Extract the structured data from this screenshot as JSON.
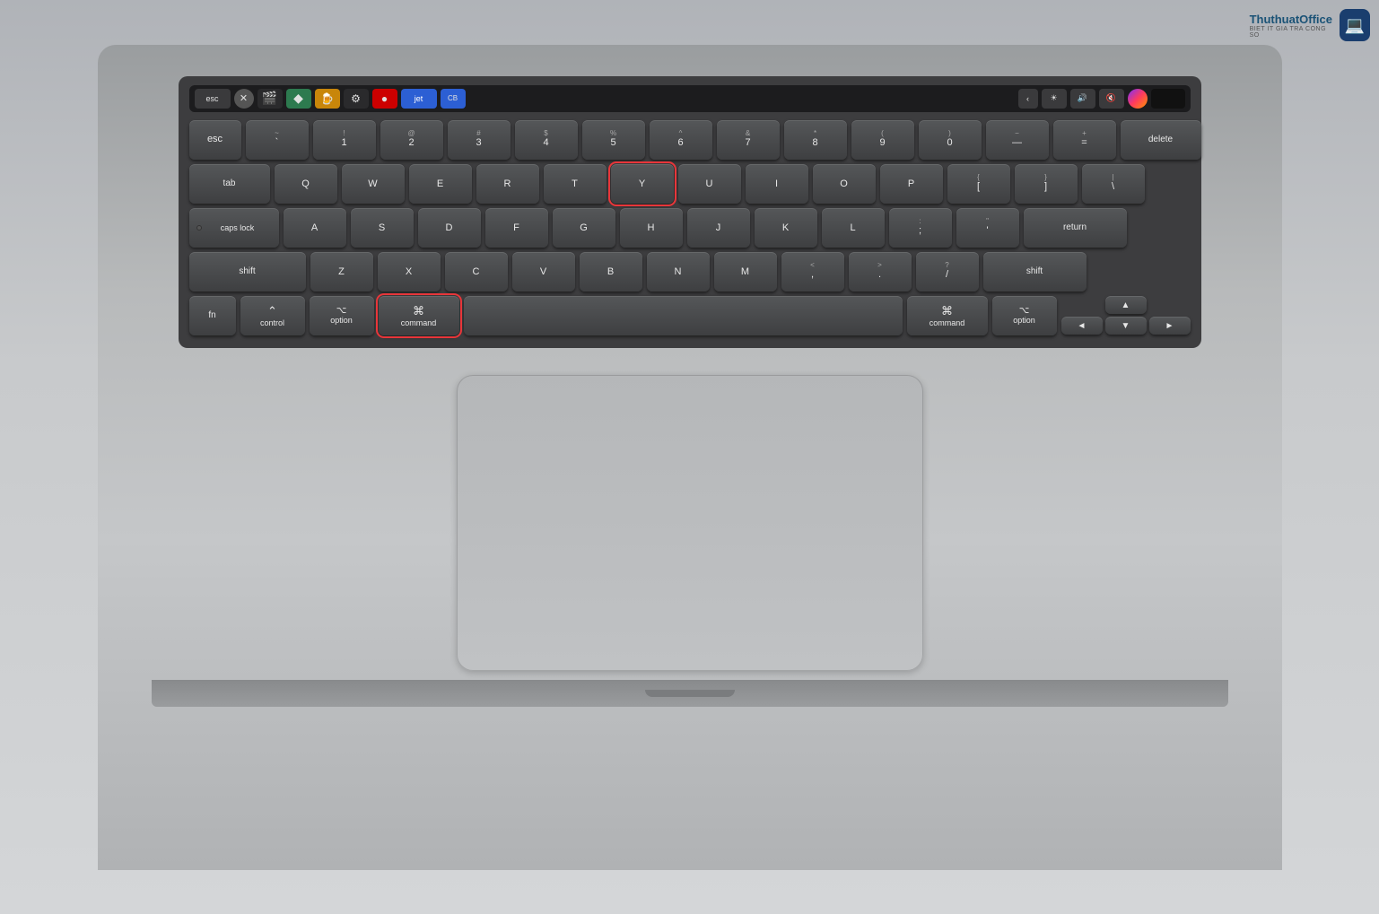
{
  "logo": {
    "name": "ThuthuatOffice",
    "sub": "BIET IT GIA TRA CONG SO",
    "icon": "💻"
  },
  "keyboard": {
    "touch_bar": {
      "keys": [
        "esc",
        "✕",
        "🎬",
        "◆",
        "🍺",
        "⚙",
        "●",
        "jet",
        "CB",
        "‹",
        "☀",
        "🔊",
        "🔇",
        "🔮",
        "■"
      ]
    },
    "rows": [
      {
        "id": "row_numbers",
        "keys": [
          {
            "label": "~\n`",
            "size": "1u"
          },
          {
            "label": "!\n1",
            "size": "1u"
          },
          {
            "label": "@\n2",
            "size": "1u"
          },
          {
            "label": "#\n3",
            "size": "1u"
          },
          {
            "label": "$\n4",
            "size": "1u"
          },
          {
            "label": "%\n5",
            "size": "1u"
          },
          {
            "label": "^\n6",
            "size": "1u"
          },
          {
            "label": "&\n7",
            "size": "1u"
          },
          {
            "label": "*\n8",
            "size": "1u"
          },
          {
            "label": "(\n9",
            "size": "1u"
          },
          {
            "label": ")\n0",
            "size": "1u"
          },
          {
            "label": "−\n—",
            "size": "1u"
          },
          {
            "label": "+\n=",
            "size": "1u"
          },
          {
            "label": "delete",
            "size": "delete"
          }
        ]
      },
      {
        "id": "row_qwerty",
        "keys": [
          {
            "label": "tab",
            "size": "tab"
          },
          {
            "label": "Q",
            "size": "1u"
          },
          {
            "label": "W",
            "size": "1u"
          },
          {
            "label": "E",
            "size": "1u"
          },
          {
            "label": "R",
            "size": "1u"
          },
          {
            "label": "T",
            "size": "1u"
          },
          {
            "label": "Y",
            "size": "1u",
            "highlight": true
          },
          {
            "label": "U",
            "size": "1u"
          },
          {
            "label": "I",
            "size": "1u"
          },
          {
            "label": "O",
            "size": "1u"
          },
          {
            "label": "P",
            "size": "1u"
          },
          {
            "label": "{\n[",
            "size": "1u"
          },
          {
            "label": "}\n]",
            "size": "1u"
          },
          {
            "label": "|\n\\",
            "size": "backslash"
          }
        ]
      },
      {
        "id": "row_asdf",
        "keys": [
          {
            "label": "caps lock",
            "size": "caps"
          },
          {
            "label": "A",
            "size": "1u"
          },
          {
            "label": "S",
            "size": "1u"
          },
          {
            "label": "D",
            "size": "1u"
          },
          {
            "label": "F",
            "size": "1u"
          },
          {
            "label": "G",
            "size": "1u"
          },
          {
            "label": "H",
            "size": "1u"
          },
          {
            "label": "J",
            "size": "1u"
          },
          {
            "label": "K",
            "size": "1u"
          },
          {
            "label": "L",
            "size": "1u"
          },
          {
            "label": ":\n;",
            "size": "1u"
          },
          {
            "label": "\"\n'",
            "size": "1u"
          },
          {
            "label": "return",
            "size": "return"
          }
        ]
      },
      {
        "id": "row_zxcv",
        "keys": [
          {
            "label": "shift",
            "size": "shift-l"
          },
          {
            "label": "Z",
            "size": "1u"
          },
          {
            "label": "X",
            "size": "1u"
          },
          {
            "label": "C",
            "size": "1u"
          },
          {
            "label": "V",
            "size": "1u"
          },
          {
            "label": "B",
            "size": "1u"
          },
          {
            "label": "N",
            "size": "1u"
          },
          {
            "label": "M",
            "size": "1u"
          },
          {
            "label": "<\n,",
            "size": "1u"
          },
          {
            "label": ">\n.",
            "size": "1u"
          },
          {
            "label": "?\n/",
            "size": "1u"
          },
          {
            "label": "shift",
            "size": "shift-r"
          }
        ]
      },
      {
        "id": "row_bottom",
        "keys": [
          {
            "label": "fn",
            "size": "fn"
          },
          {
            "label": "⌃\ncontrol",
            "size": "control"
          },
          {
            "label": "⌥\noption",
            "size": "option"
          },
          {
            "label": "⌘\ncommand",
            "size": "command",
            "highlight": true
          },
          {
            "label": "",
            "size": "space"
          },
          {
            "label": "⌘\ncommand",
            "size": "cmd-r"
          },
          {
            "label": "⌥\noption",
            "size": "opt-r"
          },
          {
            "label": "arrows",
            "size": "arrows"
          }
        ]
      }
    ]
  }
}
